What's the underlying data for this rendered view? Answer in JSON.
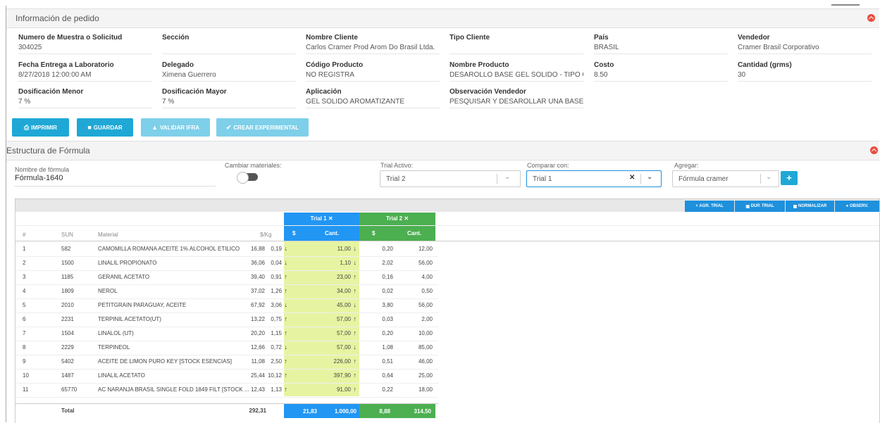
{
  "info_panel": {
    "title": "Información de pedido",
    "fields": [
      {
        "label": "Numero de Muestra o Solicitud",
        "value": "304025"
      },
      {
        "label": "Sección",
        "value": ""
      },
      {
        "label": "Nombre Cliente",
        "value": "Carlos Cramer Prod Arom Do Brasil Ltda."
      },
      {
        "label": "Tipo Cliente",
        "value": ""
      },
      {
        "label": "País",
        "value": "BRASIL"
      },
      {
        "label": "Vendedor",
        "value": "Cramer Brasil Corporativo"
      },
      {
        "label": "Fecha Entrega a Laboratorio",
        "value": "8/27/2018 12:00:00 AM"
      },
      {
        "label": "Delegado",
        "value": "Ximena Guerrero"
      },
      {
        "label": "Código Producto",
        "value": "NO REGISTRA"
      },
      {
        "label": "Nombre Producto",
        "value": "DESAROLLO BASE GEL SOLIDO - TIPO GLADE"
      },
      {
        "label": "Costo",
        "value": "8.50"
      },
      {
        "label": "Cantidad (grms)",
        "value": "30"
      },
      {
        "label": "Dosificación Menor",
        "value": "7 %"
      },
      {
        "label": "Dosificación Mayor",
        "value": "7 %"
      },
      {
        "label": "Aplicación",
        "value": "GEL SOLIDO AROMATIZANTE"
      },
      {
        "label": "Observación Vendedor",
        "value": "PESQUISAR Y DESAROLLAR UNA BASE DE G..."
      }
    ]
  },
  "actions": {
    "print": "IMPRIMIR",
    "save": "GUARDAR",
    "validate": "VALIDAR IFRA",
    "create": "CREAR EXPERIMENTAL"
  },
  "formula_panel": {
    "title": "Estructura de Fórmula",
    "name_label": "Nombre de fórmula",
    "name_value": "Fórmula-1640",
    "switch_label": "Cambiar materiales:",
    "trial_label": "Trial Activo:",
    "trial_value": "Trial 2",
    "compare_label": "Comparar con:",
    "compare_value": "Trial 1",
    "add_label": "Agregar:",
    "add_value": "Fórmula cramer",
    "plus": "+"
  },
  "table_toolbar": {
    "add_trial": "AGR. TRIAL",
    "dup_trial": "DUP. TRIAL",
    "normalize": "NORMALIZAR",
    "observ": "OBSERV."
  },
  "table": {
    "trial1_name": "Trial 1",
    "trial2_name": "Trial 2",
    "close_mark": "✕",
    "headers": {
      "num": "#",
      "sun": "SUN",
      "material": "Material",
      "perkg": "$/Kg",
      "usd": "$",
      "qty": "Cant."
    },
    "rows": [
      {
        "n": "1",
        "sun": "582",
        "mat": "CAMOMILLA ROMANA ACEITE 1% ALCOHOL ETILICO",
        "kg": "16,88",
        "t1s": "0,19",
        "t1c": "11,00",
        "t1d": "down",
        "t2s": "0,20",
        "t2c": "12,00"
      },
      {
        "n": "2",
        "sun": "1500",
        "mat": "LINALIL PROPIONATO",
        "kg": "36,06",
        "t1s": "0,04",
        "t1c": "1,10",
        "t1d": "down",
        "t2s": "2,02",
        "t2c": "56,00"
      },
      {
        "n": "3",
        "sun": "1185",
        "mat": "GERANIL ACETATO",
        "kg": "39,40",
        "t1s": "0,91",
        "t1c": "23,00",
        "t1d": "up",
        "t2s": "0,16",
        "t2c": "4,00"
      },
      {
        "n": "4",
        "sun": "1809",
        "mat": "NEROL",
        "kg": "37,02",
        "t1s": "1,26",
        "t1c": "34,00",
        "t1d": "up",
        "t2s": "0,02",
        "t2c": "0,50"
      },
      {
        "n": "5",
        "sun": "2010",
        "mat": "PETITGRAIN PARAGUAY, ACEITE",
        "kg": "67,92",
        "t1s": "3,06",
        "t1c": "45,00",
        "t1d": "down",
        "t2s": "3,80",
        "t2c": "56,00"
      },
      {
        "n": "6",
        "sun": "2231",
        "mat": "TERPINIL ACETATO(UT)",
        "kg": "13,22",
        "t1s": "0,75",
        "t1c": "57,00",
        "t1d": "up",
        "t2s": "0,03",
        "t2c": "2,00"
      },
      {
        "n": "7",
        "sun": "1504",
        "mat": "LINALOL (UT)",
        "kg": "20,20",
        "t1s": "1,15",
        "t1c": "57,00",
        "t1d": "up",
        "t2s": "0,20",
        "t2c": "10,00"
      },
      {
        "n": "8",
        "sun": "2229",
        "mat": "TERPINEOL",
        "kg": "12,66",
        "t1s": "0,72",
        "t1c": "57,00",
        "t1d": "down",
        "t2s": "1,08",
        "t2c": "85,00"
      },
      {
        "n": "9",
        "sun": "5402",
        "mat": "ACEITE DE LIMON PURO KEY [STOCK ESENCIAS]",
        "kg": "11,08",
        "t1s": "2,50",
        "t1c": "226,00",
        "t1d": "up",
        "t2s": "0,51",
        "t2c": "46,00"
      },
      {
        "n": "10",
        "sun": "1487",
        "mat": "LINALIL ACETATO",
        "kg": "25,44",
        "t1s": "10,12",
        "t1c": "397,90",
        "t1d": "up",
        "t2s": "0,64",
        "t2c": "25,00"
      },
      {
        "n": "11",
        "sun": "65770",
        "mat": "AC NARANJA BRASIL SINGLE FOLD 1849 FILT [STOCK ...",
        "kg": "12,43",
        "t1s": "1,13",
        "t1c": "91,00",
        "t1d": "up",
        "t2s": "0,22",
        "t2c": "18,00"
      }
    ],
    "total": {
      "label": "Total",
      "kg": "292,31",
      "t1s": "21,83",
      "t1c": "1.000,00",
      "t2s": "8,88",
      "t2c": "314,50"
    }
  },
  "colors": {
    "primary": "#1fa8d6",
    "trial1": "#2196f3",
    "trial2": "#4caf50",
    "highlight": "#e6f4a2",
    "danger": "#e84c3d"
  }
}
